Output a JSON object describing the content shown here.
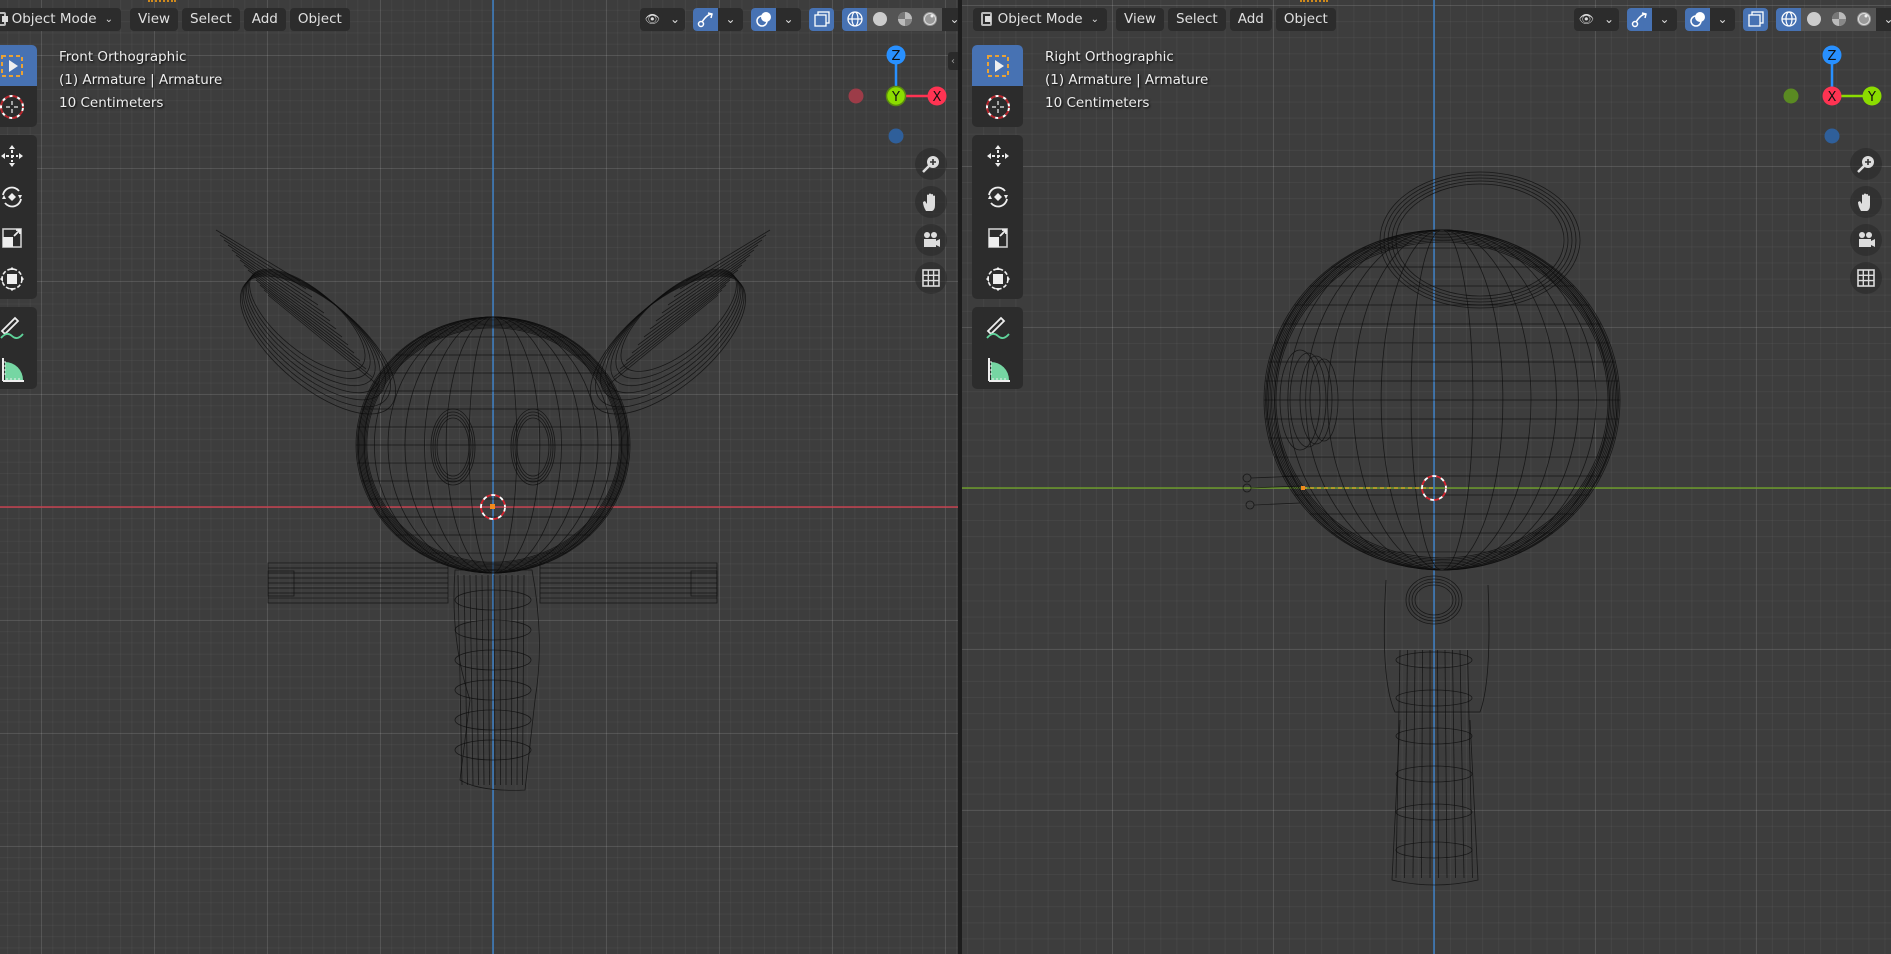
{
  "app": "Blender",
  "viewports": [
    {
      "id": "left",
      "header": {
        "mode_label": "Object Mode",
        "menus": [
          "View",
          "Select",
          "Add",
          "Object"
        ]
      },
      "overlay": {
        "view_name": "Front Orthographic",
        "object_info": "(1) Armature | Armature",
        "grid_scale": "10 Centimeters"
      },
      "gizmo": {
        "axes": [
          "Z",
          "Y",
          "X"
        ],
        "colors": {
          "x": "#ff3352",
          "y": "#8bdc00",
          "z": "#2890ff"
        }
      },
      "nav_buttons": [
        "zoom-icon",
        "hand-pan-icon",
        "camera-icon",
        "grid-ortho-icon"
      ],
      "axis_lines": {
        "horizontal": "X (red)",
        "vertical": "Z (blue)"
      }
    },
    {
      "id": "right",
      "header": {
        "mode_label": "Object Mode",
        "menus": [
          "View",
          "Select",
          "Add",
          "Object"
        ]
      },
      "overlay": {
        "view_name": "Right Orthographic",
        "object_info": "(1) Armature | Armature",
        "grid_scale": "10 Centimeters"
      },
      "gizmo": {
        "axes": [
          "Z",
          "X",
          "Y"
        ],
        "colors": {
          "x": "#ff3352",
          "y": "#8bdc00",
          "z": "#2890ff"
        }
      },
      "nav_buttons": [
        "zoom-icon",
        "hand-pan-icon",
        "camera-icon",
        "grid-ortho-icon"
      ],
      "axis_lines": {
        "horizontal": "Y (green)",
        "vertical": "Z (blue)"
      }
    }
  ],
  "header_tools": {
    "visibility": "selectability-visibility-icon",
    "gizmo": "gizmo-toggle-icon",
    "overlays": "overlays-icon",
    "xray": "xray-toggle-icon",
    "shading_modes": [
      "wireframe",
      "solid",
      "material-preview",
      "rendered"
    ],
    "active_shading": "wireframe"
  },
  "toolbar": {
    "tools": [
      "select-box",
      "cursor",
      "move",
      "rotate",
      "scale",
      "transform",
      "annotate",
      "measure"
    ],
    "active_tool": "select-box"
  },
  "colors": {
    "accent": "#4772b3",
    "background": "#3d3d3d",
    "panel": "#2c2c2c",
    "x_axis": "#c4404e",
    "y_axis": "#6b9a2a",
    "z_axis": "#3d7fc4",
    "origin": "#f08a1c"
  }
}
